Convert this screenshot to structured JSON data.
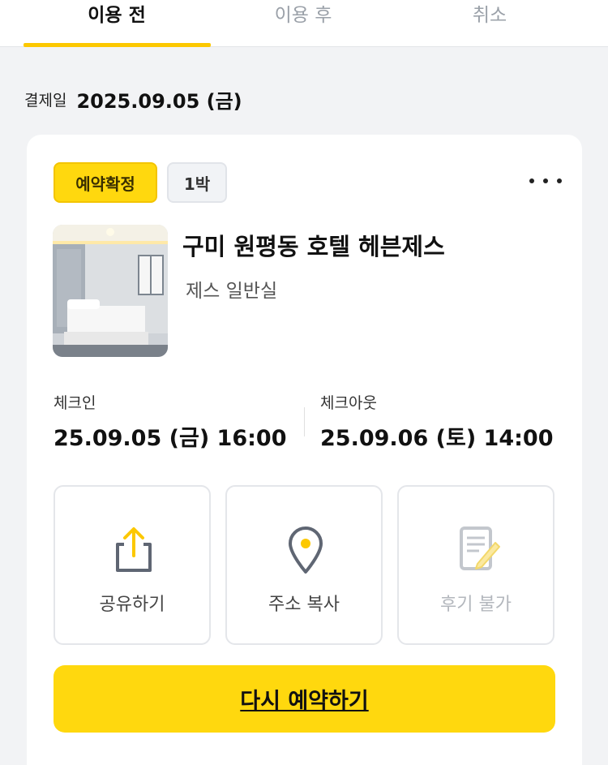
{
  "tabs": [
    {
      "label": "이용 전",
      "active": true
    },
    {
      "label": "이용 후",
      "active": false
    },
    {
      "label": "취소",
      "active": false
    }
  ],
  "payment": {
    "label": "결제일",
    "date": "2025.09.05 (금)"
  },
  "reservation": {
    "status_badge": "예약확정",
    "nights_badge": "1박",
    "more_icon": "more-dots-icon",
    "hotel_name": "구미 원평동 호텔 헤븐제스",
    "room_name": "제스 일반실",
    "checkin_label": "체크인",
    "checkin_value": "25.09.05 (금) 16:00",
    "checkout_label": "체크아웃",
    "checkout_value": "25.09.06 (토) 14:00"
  },
  "actions": [
    {
      "label": "공유하기",
      "icon": "share-icon",
      "enabled": true
    },
    {
      "label": "주소 복사",
      "icon": "location-pin-icon",
      "enabled": true
    },
    {
      "label": "후기 불가",
      "icon": "review-note-icon",
      "enabled": false
    }
  ],
  "rebook_label": "다시 예약하기",
  "colors": {
    "accent": "#ffd80e",
    "active_tab_underline": "#fcc800",
    "icon_gray": "#5f6673",
    "background": "#f2f3f5"
  }
}
